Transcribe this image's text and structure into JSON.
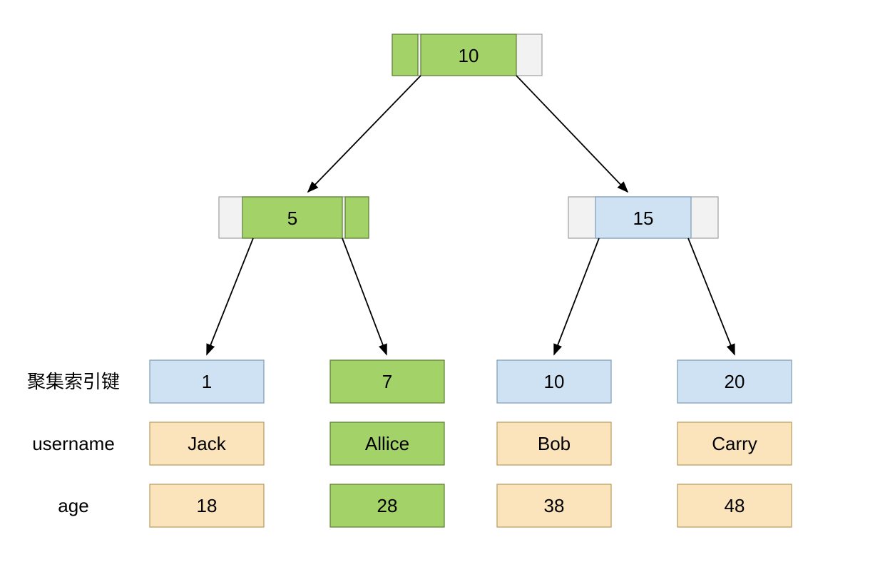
{
  "tree": {
    "root": {
      "value": "10",
      "color": "green"
    },
    "level2": [
      {
        "value": "5",
        "color": "green"
      },
      {
        "value": "15",
        "color": "blue"
      }
    ],
    "leaves": [
      {
        "key": "1",
        "username": "Jack",
        "age": "18",
        "keyColor": "blue",
        "dataColor": "cream"
      },
      {
        "key": "7",
        "username": "Allice",
        "age": "28",
        "keyColor": "green",
        "dataColor": "green"
      },
      {
        "key": "10",
        "username": "Bob",
        "age": "38",
        "keyColor": "blue",
        "dataColor": "cream"
      },
      {
        "key": "20",
        "username": "Carry",
        "age": "48",
        "keyColor": "blue",
        "dataColor": "cream"
      }
    ]
  },
  "rowLabels": {
    "key": "聚集索引键",
    "username": "username",
    "age": "age"
  }
}
